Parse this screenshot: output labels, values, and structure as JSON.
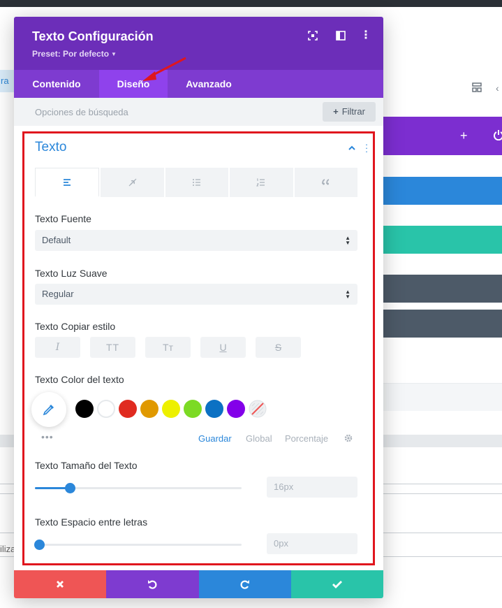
{
  "background": {
    "left_chip_text": "ra",
    "left_text": "iliza"
  },
  "modal": {
    "title": "Texto Configuración",
    "preset": "Preset: Por defecto",
    "tabs": [
      {
        "label": "Contenido"
      },
      {
        "label": "Diseño",
        "active": true
      },
      {
        "label": "Avanzado"
      }
    ],
    "search_placeholder": "Opciones de búsqueda",
    "filter_label": "Filtrar"
  },
  "section": {
    "title": "Texto",
    "subtabs": [
      {
        "icon": "align-left-icon",
        "active": true
      },
      {
        "icon": "link-off-icon"
      },
      {
        "icon": "bulleted-list-icon"
      },
      {
        "icon": "numbered-list-icon"
      },
      {
        "icon": "quote-icon"
      }
    ]
  },
  "fields": {
    "font_label": "Texto Fuente",
    "font_value": "Default",
    "weight_label": "Texto Luz Suave",
    "weight_value": "Regular",
    "style_label": "Texto Copiar estilo",
    "style_buttons": [
      "I",
      "TT",
      "Tт",
      "U",
      "S"
    ],
    "color_label": "Texto Color del texto",
    "color_swatches": [
      "#000000",
      "#ffffff",
      "#e02b20",
      "#e09900",
      "#edf000",
      "#7cda24",
      "#0c71c3",
      "#8300e9"
    ],
    "palette_links": {
      "save": "Guardar",
      "global": "Global",
      "percent": "Porcentaje"
    },
    "size_label": "Texto Tamaño del Texto",
    "size_value": "16px",
    "size_slider_fraction": 0.17,
    "spacing_label": "Texto Espacio entre letras",
    "spacing_value": "0px",
    "spacing_slider_fraction": 0.02
  },
  "colors": {
    "header": "#6c2eb9",
    "tabs": "#7e3bd0",
    "active_tab": "#8f42ec",
    "accent_blue": "#2b87da",
    "highlight_red": "#e0161e",
    "cancel": "#ef5555",
    "undo": "#7e3bd0",
    "redo": "#2b87da",
    "save": "#29c4a9"
  }
}
